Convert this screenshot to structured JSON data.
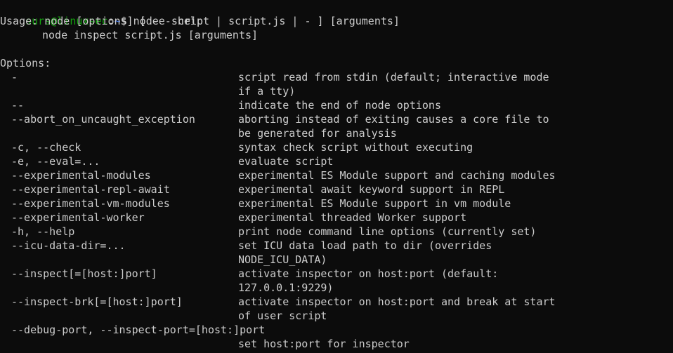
{
  "terminal": {
    "prompt": {
      "user_host": "surs@linuxsec",
      "separator": ":",
      "path": "~",
      "symbol": "$ ",
      "command": "node --help"
    },
    "usage_line1": "Usage: node [options] [ -e script | script.js | - ] [arguments]",
    "usage_line2": "node inspect script.js [arguments]",
    "options_header": "Options:",
    "options": [
      {
        "flag": "-",
        "desc": [
          "script read from stdin (default; interactive mode",
          "if a tty)"
        ]
      },
      {
        "flag": "--",
        "desc": [
          "indicate the end of node options"
        ]
      },
      {
        "flag": "--abort_on_uncaught_exception",
        "desc": [
          "aborting instead of exiting causes a core file to",
          "be generated for analysis"
        ]
      },
      {
        "flag": "-c, --check",
        "desc": [
          "syntax check script without executing"
        ]
      },
      {
        "flag": "-e, --eval=...",
        "desc": [
          "evaluate script"
        ]
      },
      {
        "flag": "--experimental-modules",
        "desc": [
          "experimental ES Module support and caching modules"
        ]
      },
      {
        "flag": "--experimental-repl-await",
        "desc": [
          "experimental await keyword support in REPL"
        ]
      },
      {
        "flag": "--experimental-vm-modules",
        "desc": [
          "experimental ES Module support in vm module"
        ]
      },
      {
        "flag": "--experimental-worker",
        "desc": [
          "experimental threaded Worker support"
        ]
      },
      {
        "flag": "-h, --help",
        "desc": [
          "print node command line options (currently set)"
        ]
      },
      {
        "flag": "--icu-data-dir=...",
        "desc": [
          "set ICU data load path to dir (overrides",
          "NODE_ICU_DATA)"
        ]
      },
      {
        "flag": "--inspect[=[host:]port]",
        "desc": [
          "activate inspector on host:port (default:",
          "127.0.0.1:9229)"
        ]
      },
      {
        "flag": "--inspect-brk[=[host:]port]",
        "desc": [
          "activate inspector on host:port and break at start",
          "of user script"
        ]
      },
      {
        "flag": "--debug-port, --inspect-port=[host:]port",
        "desc": [
          "",
          "set host:port for inspector"
        ]
      }
    ]
  },
  "colors": {
    "background": "#0c0c0c",
    "text": "#cccccc",
    "prompt_user": "#13a10e",
    "prompt_path": "#3b78ff"
  }
}
